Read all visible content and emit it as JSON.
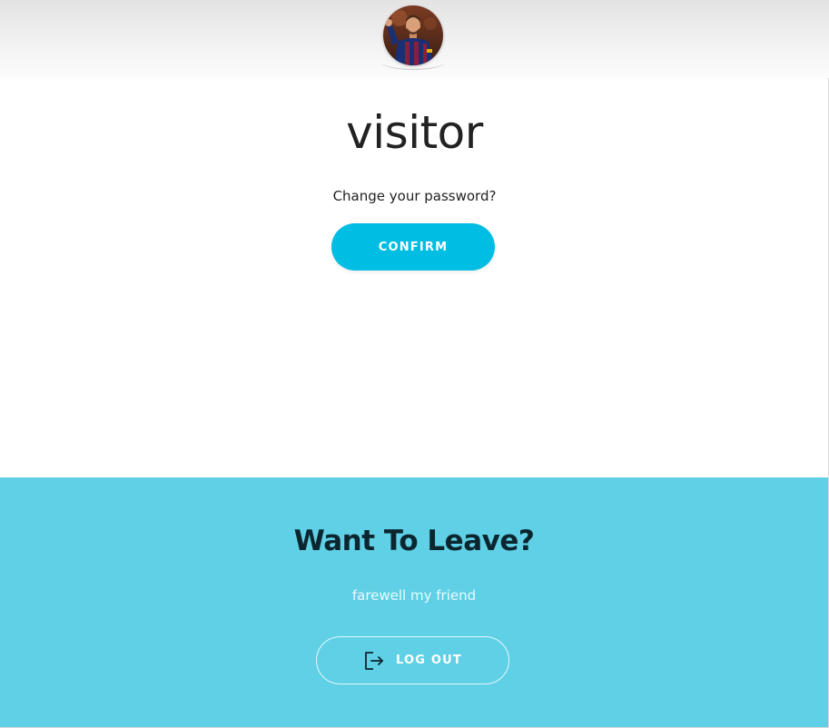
{
  "profile": {
    "username": "visitor",
    "avatar_icon": "profile-photo"
  },
  "password": {
    "question": "Change your password?",
    "confirm_label": "CONFIRM"
  },
  "leave": {
    "title": "Want To Leave?",
    "subtitle": "farewell my friend",
    "logout_label": "LOG OUT",
    "logout_icon": "logout-icon"
  },
  "colors": {
    "accent": "#00bde3",
    "leave_background": "#5fd0e5",
    "leave_title": "#0c2630"
  }
}
